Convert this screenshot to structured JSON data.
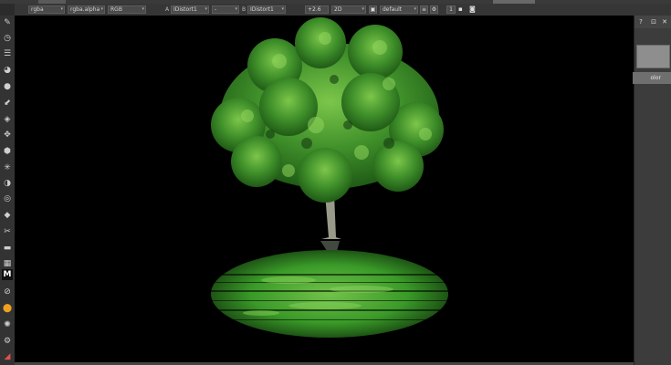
{
  "toolbar": {
    "channels": "rgba",
    "alpha_channel": "rgba.alpha",
    "display_mode": "RGB",
    "input_a_label": "A",
    "input_a": "IDistort1",
    "input_a_op": "-",
    "input_b_label": "B",
    "input_b": "IDistort1",
    "gain": "+2.6",
    "view_mode": "2D",
    "lut": "default",
    "frame_field": "1"
  },
  "right_panel": {
    "color_label": "olor"
  },
  "colors": {
    "foliage": "#3f8f2a",
    "reflection": "#3a9a28",
    "trunk": "#9a9a8a",
    "background": "#000000"
  }
}
